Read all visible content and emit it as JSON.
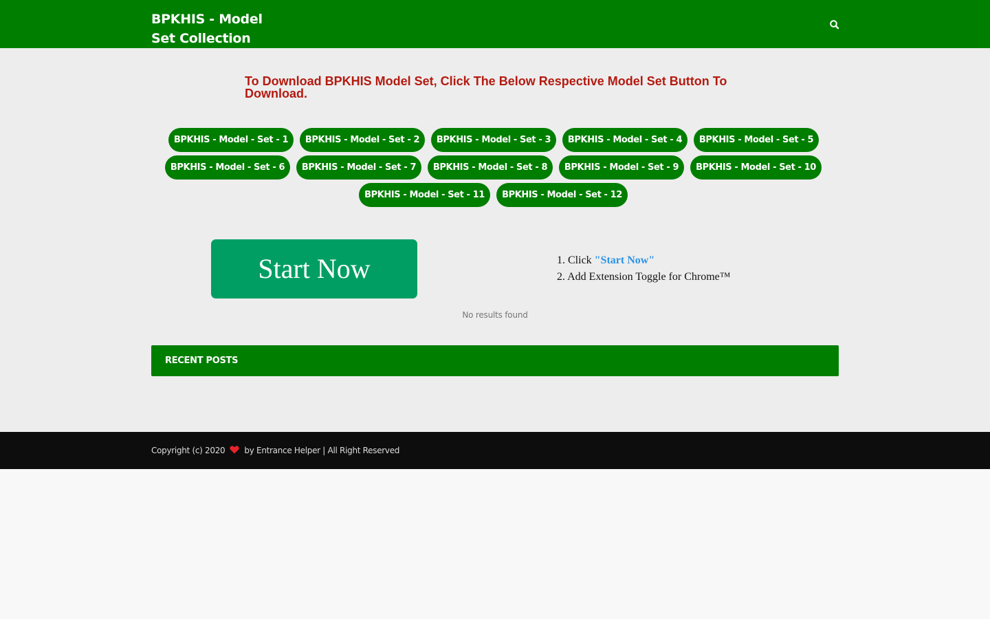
{
  "header": {
    "site_title": "BPKHIS - Model Set Collection",
    "search_icon": "search-icon",
    "background_color": "#007e00"
  },
  "main": {
    "heading": "To Download BPKHIS Model Set, Click The Below Respective Model Set Button To Download.",
    "heading_color": "#b41a10",
    "model_buttons": [
      "BPKHIS - Model - Set - 1",
      "BPKHIS - Model - Set - 2",
      "BPKHIS - Model - Set - 3",
      "BPKHIS - Model - Set - 4",
      "BPKHIS - Model - Set - 5",
      "BPKHIS - Model - Set - 6",
      "BPKHIS - Model - Set - 7",
      "BPKHIS - Model - Set - 8",
      "BPKHIS - Model - Set - 9",
      "BPKHIS - Model - Set - 10",
      "BPKHIS - Model - Set - 11",
      "BPKHIS - Model - Set - 12"
    ],
    "ad": {
      "button_label": "Start Now",
      "button_color": "#019e63",
      "steps": {
        "step1_prefix": "1. Click ",
        "step1_link": "\"Start Now\"",
        "step2": "2. Add Extension Toggle for Chrome™"
      }
    },
    "no_results": "No results found",
    "recent_posts_title": "RECENT POSTS"
  },
  "footer": {
    "copyright_prefix": "Copyright (c) 2020",
    "heart_icon": "heart-icon",
    "heart_color": "#e8232a",
    "copyright_suffix": "by Entrance Helper | All Right Reserved"
  }
}
